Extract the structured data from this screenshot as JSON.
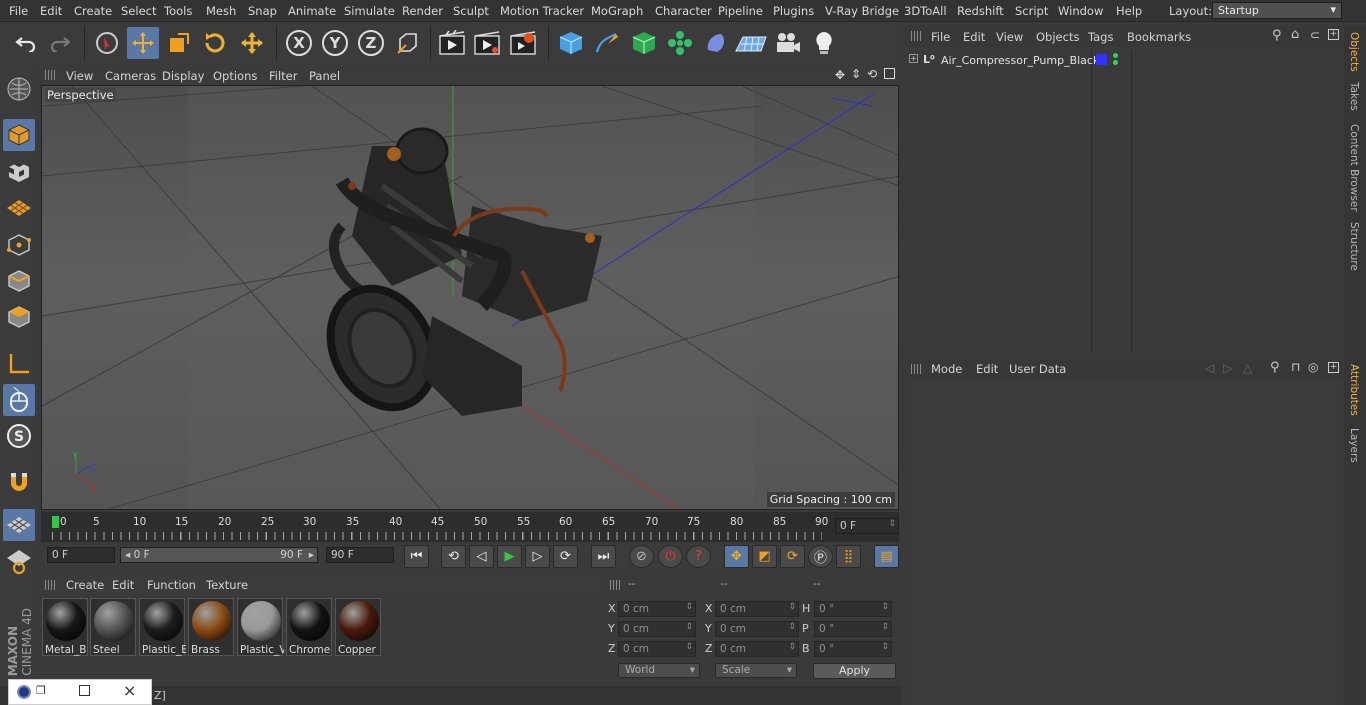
{
  "menubar": {
    "items": [
      "File",
      "Edit",
      "Create",
      "Select",
      "Tools",
      "Mesh",
      "Snap",
      "Animate",
      "Simulate",
      "Render",
      "Sculpt",
      "Motion Tracker",
      "MoGraph",
      "Character",
      "Pipeline",
      "Plugins",
      "V-Ray Bridge",
      "3DToAll",
      "Redshift",
      "Script",
      "Window",
      "Help"
    ],
    "layout_label": "Layout:",
    "layout_value": "Startup"
  },
  "toolbar": {
    "x_label": "X",
    "y_label": "Y",
    "z_label": "Z"
  },
  "viewport": {
    "menu": [
      "View",
      "Cameras",
      "Display",
      "Options",
      "Filter",
      "Panel"
    ],
    "label": "Perspective",
    "grid_spacing": "Grid Spacing : 100 cm"
  },
  "timeline": {
    "ticks": [
      "0",
      "5",
      "10",
      "15",
      "20",
      "25",
      "30",
      "35",
      "40",
      "45",
      "50",
      "55",
      "60",
      "65",
      "70",
      "75",
      "80",
      "85",
      "90"
    ],
    "current_frame": "0 F"
  },
  "transport": {
    "start_frame": "0 F",
    "range_start": "0 F",
    "range_end": "90 F",
    "end_frame": "90 F"
  },
  "materials": {
    "menu": [
      "Create",
      "Edit",
      "Function",
      "Texture"
    ],
    "items": [
      {
        "name": "Metal_B",
        "color": "#161616"
      },
      {
        "name": "Steel",
        "color": "#555555"
      },
      {
        "name": "Plastic_E",
        "color": "#1c1c1c"
      },
      {
        "name": "Brass",
        "color": "#8a4a14"
      },
      {
        "name": "Plastic_V",
        "color": "#9a9a9a"
      },
      {
        "name": "Chrome",
        "color": "#141414"
      },
      {
        "name": "Copper",
        "color": "#4a1a0c"
      }
    ]
  },
  "coords": {
    "headers": [
      "--",
      "--",
      "--"
    ],
    "rows": [
      {
        "a_label": "X",
        "a_val": "0 cm",
        "b_label": "X",
        "b_val": "0 cm",
        "c_label": "H",
        "c_val": "0 °"
      },
      {
        "a_label": "Y",
        "a_val": "0 cm",
        "b_label": "Y",
        "b_val": "0 cm",
        "c_label": "P",
        "c_val": "0 °"
      },
      {
        "a_label": "Z",
        "a_val": "0 cm",
        "b_label": "Z",
        "b_val": "0 cm",
        "c_label": "B",
        "c_val": "0 °"
      }
    ],
    "space": "World",
    "mode": "Scale",
    "apply": "Apply"
  },
  "objects": {
    "menu": [
      "File",
      "Edit",
      "View",
      "Objects",
      "Tags",
      "Bookmarks"
    ],
    "items": [
      {
        "name": "Air_Compressor_Pump_Black",
        "color": "#3232ff"
      }
    ]
  },
  "attributes": {
    "menu": [
      "Mode",
      "Edit",
      "User Data"
    ]
  },
  "sidetabs": [
    "Objects",
    "Takes",
    "Content Browser",
    "Structure",
    "Attributes",
    "Layers"
  ],
  "brand": {
    "line1": "MAXON",
    "line2": "CINEMA 4D"
  },
  "status": {
    "text": "Z]"
  }
}
